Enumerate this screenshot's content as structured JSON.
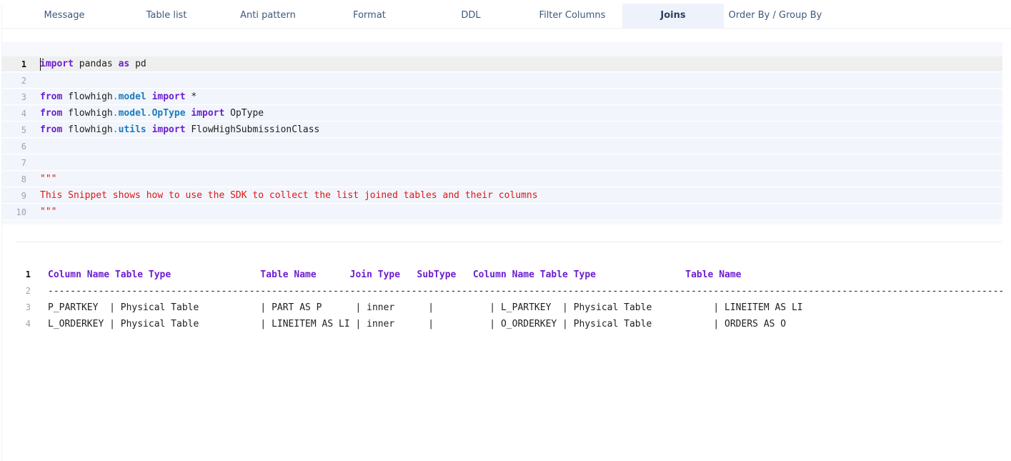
{
  "tabs": [
    {
      "label": "Message",
      "active": false
    },
    {
      "label": "Table list",
      "active": false
    },
    {
      "label": "Anti pattern",
      "active": false
    },
    {
      "label": "Format",
      "active": false
    },
    {
      "label": "DDL",
      "active": false
    },
    {
      "label": "Filter Columns",
      "active": false
    },
    {
      "label": "Joins",
      "active": true
    },
    {
      "label": "Order By / Group By",
      "active": false
    }
  ],
  "editor": {
    "lines": [
      {
        "num": "1",
        "tokens": [
          {
            "t": "import",
            "c": "kw"
          },
          {
            "t": " pandas ",
            "c": ""
          },
          {
            "t": "as",
            "c": "kw"
          },
          {
            "t": " pd",
            "c": ""
          }
        ]
      },
      {
        "num": "2",
        "tokens": []
      },
      {
        "num": "3",
        "tokens": [
          {
            "t": "from",
            "c": "kw"
          },
          {
            "t": " flowhigh",
            "c": ""
          },
          {
            "t": ".",
            "c": "dot"
          },
          {
            "t": "model",
            "c": "attr"
          },
          {
            "t": " ",
            "c": ""
          },
          {
            "t": "import",
            "c": "kw"
          },
          {
            "t": " *",
            "c": ""
          }
        ]
      },
      {
        "num": "4",
        "tokens": [
          {
            "t": "from",
            "c": "kw"
          },
          {
            "t": " flowhigh",
            "c": ""
          },
          {
            "t": ".",
            "c": "dot"
          },
          {
            "t": "model",
            "c": "attr"
          },
          {
            "t": ".",
            "c": "dot"
          },
          {
            "t": "OpType",
            "c": "attr"
          },
          {
            "t": " ",
            "c": ""
          },
          {
            "t": "import",
            "c": "kw"
          },
          {
            "t": " OpType",
            "c": ""
          }
        ]
      },
      {
        "num": "5",
        "tokens": [
          {
            "t": "from",
            "c": "kw"
          },
          {
            "t": " flowhigh",
            "c": ""
          },
          {
            "t": ".",
            "c": "dot"
          },
          {
            "t": "utils",
            "c": "attr"
          },
          {
            "t": " ",
            "c": ""
          },
          {
            "t": "import",
            "c": "kw"
          },
          {
            "t": " FlowHighSubmissionClass",
            "c": ""
          }
        ]
      },
      {
        "num": "6",
        "tokens": []
      },
      {
        "num": "7",
        "tokens": []
      },
      {
        "num": "8",
        "tokens": [
          {
            "t": "\"\"\"",
            "c": "str"
          }
        ]
      },
      {
        "num": "9",
        "tokens": [
          {
            "t": "This Snippet shows how to use the SDK to collect the list joined tables and their columns",
            "c": "str"
          }
        ]
      },
      {
        "num": "10",
        "tokens": [
          {
            "t": "\"\"\"",
            "c": "str"
          }
        ]
      }
    ]
  },
  "output": {
    "lines": [
      {
        "num": "1",
        "text": "Column Name Table Type                Table Name      Join Type   SubType   Column Name Table Type                Table Name"
      },
      {
        "num": "2",
        "text": "--------------------------------------------------------------------------------------------------------------------------------------------------------------------------------------"
      },
      {
        "num": "3",
        "text": "P_PARTKEY  | Physical Table           | PART AS P      | inner      |          | L_PARTKEY  | Physical Table           | LINEITEM AS LI"
      },
      {
        "num": "4",
        "text": "L_ORDERKEY | Physical Table           | LINEITEM AS LI | inner      |          | O_ORDERKEY | Physical Table           | ORDERS AS O"
      }
    ]
  },
  "colors": {
    "keyword": "#6c1ed1",
    "attribute": "#1d7bbd",
    "string": "#e01515",
    "active_tab_bg": "#eef3fb"
  }
}
